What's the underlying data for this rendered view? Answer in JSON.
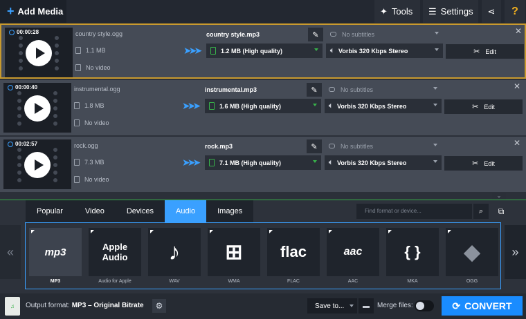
{
  "toolbar": {
    "add_media": "Add Media",
    "tools": "Tools",
    "settings": "Settings"
  },
  "files": [
    {
      "duration": "00:00:28",
      "source_name": "country style.ogg",
      "source_size": "1.1 MB",
      "video": "No video",
      "output_name": "country style.mp3",
      "subtitles": "No subtitles",
      "output_size": "1.2 MB (High quality)",
      "audio": "Vorbis 320 Kbps Stereo",
      "edit": "Edit"
    },
    {
      "duration": "00:00:40",
      "source_name": "instrumental.ogg",
      "source_size": "1.8 MB",
      "video": "No video",
      "output_name": "instrumental.mp3",
      "subtitles": "No subtitles",
      "output_size": "1.6 MB (High quality)",
      "audio": "Vorbis 320 Kbps Stereo",
      "edit": "Edit"
    },
    {
      "duration": "00:02:57",
      "source_name": "rock.ogg",
      "source_size": "7.3 MB",
      "video": "No video",
      "output_name": "rock.mp3",
      "subtitles": "No subtitles",
      "output_size": "7.1 MB (High quality)",
      "audio": "Vorbis 320 Kbps Stereo",
      "edit": "Edit"
    }
  ],
  "tabs": [
    "Popular",
    "Video",
    "Devices",
    "Audio",
    "Images"
  ],
  "active_tab": "Audio",
  "search": {
    "placeholder": "Find format or device..."
  },
  "formats": [
    {
      "label": "MP3",
      "tile_text": "mp3"
    },
    {
      "label": "Audio for Apple",
      "tile_text": "Apple Audio"
    },
    {
      "label": "WAV",
      "tile_text": "♪"
    },
    {
      "label": "WMA",
      "tile_text": "⊞"
    },
    {
      "label": "FLAC",
      "tile_text": "flac"
    },
    {
      "label": "AAC",
      "tile_text": "aac"
    },
    {
      "label": "MKA",
      "tile_text": "{ }"
    },
    {
      "label": "OGG",
      "tile_text": "◆"
    }
  ],
  "statusbar": {
    "output_format_label": "Output format:",
    "output_format_value": "MP3 – Original Bitrate",
    "save_to": "Save to...",
    "merge_files": "Merge files:",
    "convert": "CONVERT"
  },
  "colors": {
    "accent": "#3aa0ff",
    "selected_border": "#c99a2e",
    "green": "#38b24a"
  }
}
